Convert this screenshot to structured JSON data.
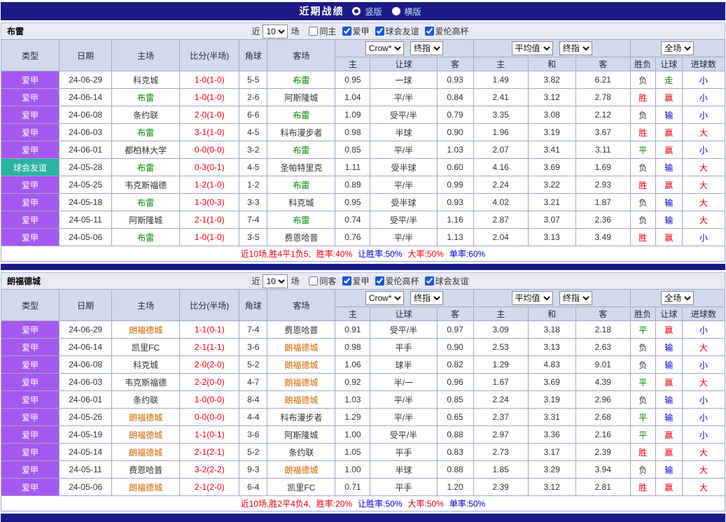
{
  "topbar": {
    "title": "近期战绩",
    "radios": [
      {
        "label": "竖版",
        "selected": true
      },
      {
        "label": "横版",
        "selected": false
      }
    ]
  },
  "palette": {
    "navy": "#1b1b87",
    "header_bg": "#d2d9ea",
    "section_bar_bg": "#e9e9f4",
    "grid_border": "#a0aac8",
    "league_purple": "#a559f0",
    "friendly_teal": "#2bb3a3",
    "win_red": "#e60012",
    "lose_blue": "#0000cc",
    "draw_green": "#008800",
    "team1_highlight": "#008800",
    "team2_highlight": "#cc6600"
  },
  "table": {
    "left_headers": [
      "类型",
      "日期",
      "主场",
      "比分(半场)",
      "角球",
      "客场"
    ],
    "sub_headers": [
      "主",
      "让球",
      "客",
      "主",
      "和",
      "客",
      "胜负",
      "让球",
      "进球数"
    ]
  },
  "sections": [
    {
      "team": "布雷",
      "filter": {
        "prefix": "近",
        "count": "10",
        "suffix": "场",
        "checkboxes": [
          {
            "label": "同主",
            "checked": false
          },
          {
            "label": "爱甲",
            "checked": true
          },
          {
            "label": "球会友谊",
            "checked": true
          },
          {
            "label": "爱伦高杯",
            "checked": true
          }
        ]
      },
      "dropdowns": {
        "company": "Crow*",
        "company_stage": "终指",
        "avg": "平均值",
        "avg_stage": "终指",
        "scope": "全场"
      },
      "rows": [
        {
          "type": "爱甲",
          "type_style": "league",
          "date": "24-06-29",
          "home": "科克城",
          "home_color": "dark",
          "score": "1-0(1-0)",
          "corner": "5-5",
          "away": "布雷",
          "away_color": "green",
          "odds_home": "0.95",
          "handicap": "一球",
          "odds_away": "0.93",
          "avg_home": "1.49",
          "avg_draw": "3.82",
          "avg_away": "6.21",
          "result": "负",
          "result_color": "dark",
          "let_result": "走",
          "let_color": "green",
          "goals": "小",
          "goals_color": "blue"
        },
        {
          "type": "爱甲",
          "type_style": "league",
          "date": "24-06-14",
          "home": "布雷",
          "home_color": "green",
          "score": "1-0(1-0)",
          "corner": "2-6",
          "away": "阿斯隆城",
          "away_color": "dark",
          "odds_home": "1.04",
          "handicap": "平/半",
          "odds_away": "0.84",
          "avg_home": "2.41",
          "avg_draw": "3.12",
          "avg_away": "2.78",
          "result": "胜",
          "result_color": "red",
          "let_result": "赢",
          "let_color": "red",
          "goals": "小",
          "goals_color": "blue"
        },
        {
          "type": "爱甲",
          "type_style": "league",
          "date": "24-06-08",
          "home": "条约联",
          "home_color": "dark",
          "score": "2-0(1-0)",
          "corner": "6-6",
          "away": "布雷",
          "away_color": "green",
          "odds_home": "1.09",
          "handicap": "受平/半",
          "odds_away": "0.79",
          "avg_home": "3.35",
          "avg_draw": "3.08",
          "avg_away": "2.12",
          "result": "负",
          "result_color": "dark",
          "let_result": "输",
          "let_color": "blue",
          "goals": "小",
          "goals_color": "blue"
        },
        {
          "type": "爱甲",
          "type_style": "league",
          "date": "24-06-03",
          "home": "布雷",
          "home_color": "green",
          "score": "3-1(1-0)",
          "corner": "4-5",
          "away": "科布漫步者",
          "away_color": "dark",
          "odds_home": "0.98",
          "handicap": "半球",
          "odds_away": "0.90",
          "avg_home": "1.96",
          "avg_draw": "3.19",
          "avg_away": "3.67",
          "result": "胜",
          "result_color": "red",
          "let_result": "赢",
          "let_color": "red",
          "goals": "大",
          "goals_color": "red"
        },
        {
          "type": "爱甲",
          "type_style": "league",
          "date": "24-06-01",
          "home": "都柏林大学",
          "home_color": "dark",
          "score": "0-0(0-0)",
          "corner": "3-2",
          "away": "布雷",
          "away_color": "green",
          "odds_home": "0.85",
          "handicap": "平/半",
          "odds_away": "1.03",
          "avg_home": "2.07",
          "avg_draw": "3.41",
          "avg_away": "3.11",
          "result": "平",
          "result_color": "green",
          "let_result": "赢",
          "let_color": "red",
          "goals": "小",
          "goals_color": "blue"
        },
        {
          "type": "球会友谊",
          "type_style": "friendly",
          "date": "24-05-28",
          "home": "布雷",
          "home_color": "green",
          "score": "0-3(0-1)",
          "corner": "4-5",
          "away": "圣帕特里克",
          "away_color": "dark",
          "odds_home": "1.11",
          "handicap": "受半球",
          "odds_away": "0.60",
          "avg_home": "4.16",
          "avg_draw": "3.69",
          "avg_away": "1.69",
          "result": "负",
          "result_color": "dark",
          "let_result": "输",
          "let_color": "blue",
          "goals": "大",
          "goals_color": "red"
        },
        {
          "type": "爱甲",
          "type_style": "league",
          "date": "24-05-25",
          "home": "韦克斯福德",
          "home_color": "dark",
          "score": "1-2(1-0)",
          "corner": "1-2",
          "away": "布雷",
          "away_color": "green",
          "odds_home": "0.89",
          "handicap": "平/半",
          "odds_away": "0.99",
          "avg_home": "2.24",
          "avg_draw": "3.22",
          "avg_away": "2.93",
          "result": "胜",
          "result_color": "red",
          "let_result": "赢",
          "let_color": "red",
          "goals": "大",
          "goals_color": "red"
        },
        {
          "type": "爱甲",
          "type_style": "league",
          "date": "24-05-18",
          "home": "布雷",
          "home_color": "green",
          "score": "1-3(0-3)",
          "corner": "3-3",
          "away": "科克城",
          "away_color": "dark",
          "odds_home": "0.95",
          "handicap": "受半球",
          "odds_away": "0.93",
          "avg_home": "4.02",
          "avg_draw": "3.21",
          "avg_away": "1.87",
          "result": "负",
          "result_color": "dark",
          "let_result": "输",
          "let_color": "blue",
          "goals": "大",
          "goals_color": "red"
        },
        {
          "type": "爱甲",
          "type_style": "league",
          "date": "24-05-11",
          "home": "阿斯隆城",
          "home_color": "dark",
          "score": "2-1(1-0)",
          "corner": "7-4",
          "away": "布雷",
          "away_color": "green",
          "odds_home": "0.74",
          "handicap": "受平/半",
          "odds_away": "1.16",
          "avg_home": "2.87",
          "avg_draw": "3.07",
          "avg_away": "2.36",
          "result": "负",
          "result_color": "dark",
          "let_result": "输",
          "let_color": "blue",
          "goals": "大",
          "goals_color": "red"
        },
        {
          "type": "爱甲",
          "type_style": "league",
          "date": "24-05-06",
          "home": "布雷",
          "home_color": "green",
          "score": "1-0(1-0)",
          "corner": "3-5",
          "away": "费恩哈普",
          "away_color": "dark",
          "odds_home": "0.76",
          "handicap": "平/半",
          "odds_away": "1.13",
          "avg_home": "2.04",
          "avg_draw": "3.13",
          "avg_away": "3.49",
          "result": "胜",
          "result_color": "red",
          "let_result": "赢",
          "let_color": "red",
          "goals": "小",
          "goals_color": "blue"
        }
      ],
      "summary": [
        {
          "text": "近10场,胜4平1负5,",
          "color": "red"
        },
        {
          "text": "胜率:40%",
          "color": "red"
        },
        {
          "text": "让胜率:50%",
          "color": "blue"
        },
        {
          "text": "大率:50%",
          "color": "red"
        },
        {
          "text": "单率:60%",
          "color": "blue"
        }
      ]
    },
    {
      "team": "朗福德城",
      "filter": {
        "prefix": "近",
        "count": "10",
        "suffix": "场",
        "checkboxes": [
          {
            "label": "同客",
            "checked": false
          },
          {
            "label": "爱甲",
            "checked": true
          },
          {
            "label": "爱伦高杯",
            "checked": true
          },
          {
            "label": "球会友谊",
            "checked": true
          }
        ]
      },
      "dropdowns": {
        "company": "Crow*",
        "company_stage": "终指",
        "avg": "平均值",
        "avg_stage": "终指",
        "scope": "全场"
      },
      "rows": [
        {
          "type": "爱甲",
          "type_style": "league",
          "date": "24-06-29",
          "home": "朗福德城",
          "home_color": "orange",
          "score": "1-1(0-1)",
          "corner": "7-4",
          "away": "费恩哈普",
          "away_color": "dark",
          "odds_home": "0.91",
          "handicap": "受平/半",
          "odds_away": "0.97",
          "avg_home": "3.09",
          "avg_draw": "3.18",
          "avg_away": "2.18",
          "result": "平",
          "result_color": "green",
          "let_result": "赢",
          "let_color": "red",
          "goals": "小",
          "goals_color": "blue"
        },
        {
          "type": "爱甲",
          "type_style": "league",
          "date": "24-06-14",
          "home": "凯里FC",
          "home_color": "dark",
          "score": "2-1(1-1)",
          "corner": "3-6",
          "away": "朗福德城",
          "away_color": "orange",
          "odds_home": "0.98",
          "handicap": "平手",
          "odds_away": "0.90",
          "avg_home": "2.53",
          "avg_draw": "3.13",
          "avg_away": "2.63",
          "result": "负",
          "result_color": "dark",
          "let_result": "输",
          "let_color": "blue",
          "goals": "大",
          "goals_color": "red"
        },
        {
          "type": "爱甲",
          "type_style": "league",
          "date": "24-06-08",
          "home": "科克城",
          "home_color": "dark",
          "score": "2-0(2-0)",
          "corner": "5-2",
          "away": "朗福德城",
          "away_color": "orange",
          "odds_home": "1.06",
          "handicap": "球半",
          "odds_away": "0.82",
          "avg_home": "1.29",
          "avg_draw": "4.83",
          "avg_away": "9.01",
          "result": "负",
          "result_color": "dark",
          "let_result": "输",
          "let_color": "blue",
          "goals": "小",
          "goals_color": "blue"
        },
        {
          "type": "爱甲",
          "type_style": "league",
          "date": "24-06-03",
          "home": "韦克斯福德",
          "home_color": "dark",
          "score": "2-2(0-0)",
          "corner": "4-7",
          "away": "朗福德城",
          "away_color": "orange",
          "odds_home": "0.92",
          "handicap": "半/一",
          "odds_away": "0.96",
          "avg_home": "1.67",
          "avg_draw": "3.69",
          "avg_away": "4.39",
          "result": "平",
          "result_color": "green",
          "let_result": "赢",
          "let_color": "red",
          "goals": "大",
          "goals_color": "red"
        },
        {
          "type": "爱甲",
          "type_style": "league",
          "date": "24-06-01",
          "home": "条约联",
          "home_color": "dark",
          "score": "1-0(0-0)",
          "corner": "8-4",
          "away": "朗福德城",
          "away_color": "orange",
          "odds_home": "1.03",
          "handicap": "平/半",
          "odds_away": "0.85",
          "avg_home": "2.24",
          "avg_draw": "3.19",
          "avg_away": "2.96",
          "result": "负",
          "result_color": "dark",
          "let_result": "输",
          "let_color": "blue",
          "goals": "小",
          "goals_color": "blue"
        },
        {
          "type": "爱甲",
          "type_style": "league",
          "date": "24-05-26",
          "home": "朗福德城",
          "home_color": "orange",
          "score": "0-0(0-0)",
          "corner": "4-4",
          "away": "科布漫步者",
          "away_color": "dark",
          "odds_home": "1.29",
          "handicap": "平/半",
          "odds_away": "0.65",
          "avg_home": "2.37",
          "avg_draw": "3.31",
          "avg_away": "2.68",
          "result": "平",
          "result_color": "green",
          "let_result": "输",
          "let_color": "blue",
          "goals": "小",
          "goals_color": "blue"
        },
        {
          "type": "爱甲",
          "type_style": "league",
          "date": "24-05-19",
          "home": "朗福德城",
          "home_color": "orange",
          "score": "1-1(0-1)",
          "corner": "3-6",
          "away": "阿斯隆城",
          "away_color": "dark",
          "odds_home": "1.00",
          "handicap": "受平/半",
          "odds_away": "0.88",
          "avg_home": "2.97",
          "avg_draw": "3.36",
          "avg_away": "2.16",
          "result": "平",
          "result_color": "green",
          "let_result": "赢",
          "let_color": "red",
          "goals": "小",
          "goals_color": "blue"
        },
        {
          "type": "爱甲",
          "type_style": "league",
          "date": "24-05-14",
          "home": "朗福德城",
          "home_color": "orange",
          "score": "2-1(2-1)",
          "corner": "5-2",
          "away": "条约联",
          "away_color": "dark",
          "odds_home": "1.05",
          "handicap": "平手",
          "odds_away": "0.83",
          "avg_home": "2.73",
          "avg_draw": "3.17",
          "avg_away": "2.39",
          "result": "胜",
          "result_color": "red",
          "let_result": "赢",
          "let_color": "red",
          "goals": "大",
          "goals_color": "red"
        },
        {
          "type": "爱甲",
          "type_style": "league",
          "date": "24-05-11",
          "home": "费恩哈普",
          "home_color": "dark",
          "score": "3-2(2-2)",
          "corner": "9-3",
          "away": "朗福德城",
          "away_color": "orange",
          "odds_home": "1.00",
          "handicap": "半球",
          "odds_away": "0.88",
          "avg_home": "1.85",
          "avg_draw": "3.29",
          "avg_away": "3.94",
          "result": "负",
          "result_color": "dark",
          "let_result": "输",
          "let_color": "blue",
          "goals": "大",
          "goals_color": "red"
        },
        {
          "type": "爱甲",
          "type_style": "league",
          "date": "24-05-06",
          "home": "朗福德城",
          "home_color": "orange",
          "score": "2-1(2-0)",
          "corner": "6-4",
          "away": "凯里FC",
          "away_color": "dark",
          "odds_home": "0.71",
          "handicap": "平手",
          "odds_away": "1.20",
          "avg_home": "2.39",
          "avg_draw": "3.12",
          "avg_away": "2.81",
          "result": "胜",
          "result_color": "red",
          "let_result": "赢",
          "let_color": "red",
          "goals": "大",
          "goals_color": "red"
        }
      ],
      "summary": [
        {
          "text": "近10场,胜2平4负4,",
          "color": "red"
        },
        {
          "text": "胜率:20%",
          "color": "red"
        },
        {
          "text": "让胜率:50%",
          "color": "blue"
        },
        {
          "text": "大率:50%",
          "color": "red"
        },
        {
          "text": "单率:50%",
          "color": "blue"
        }
      ]
    }
  ]
}
